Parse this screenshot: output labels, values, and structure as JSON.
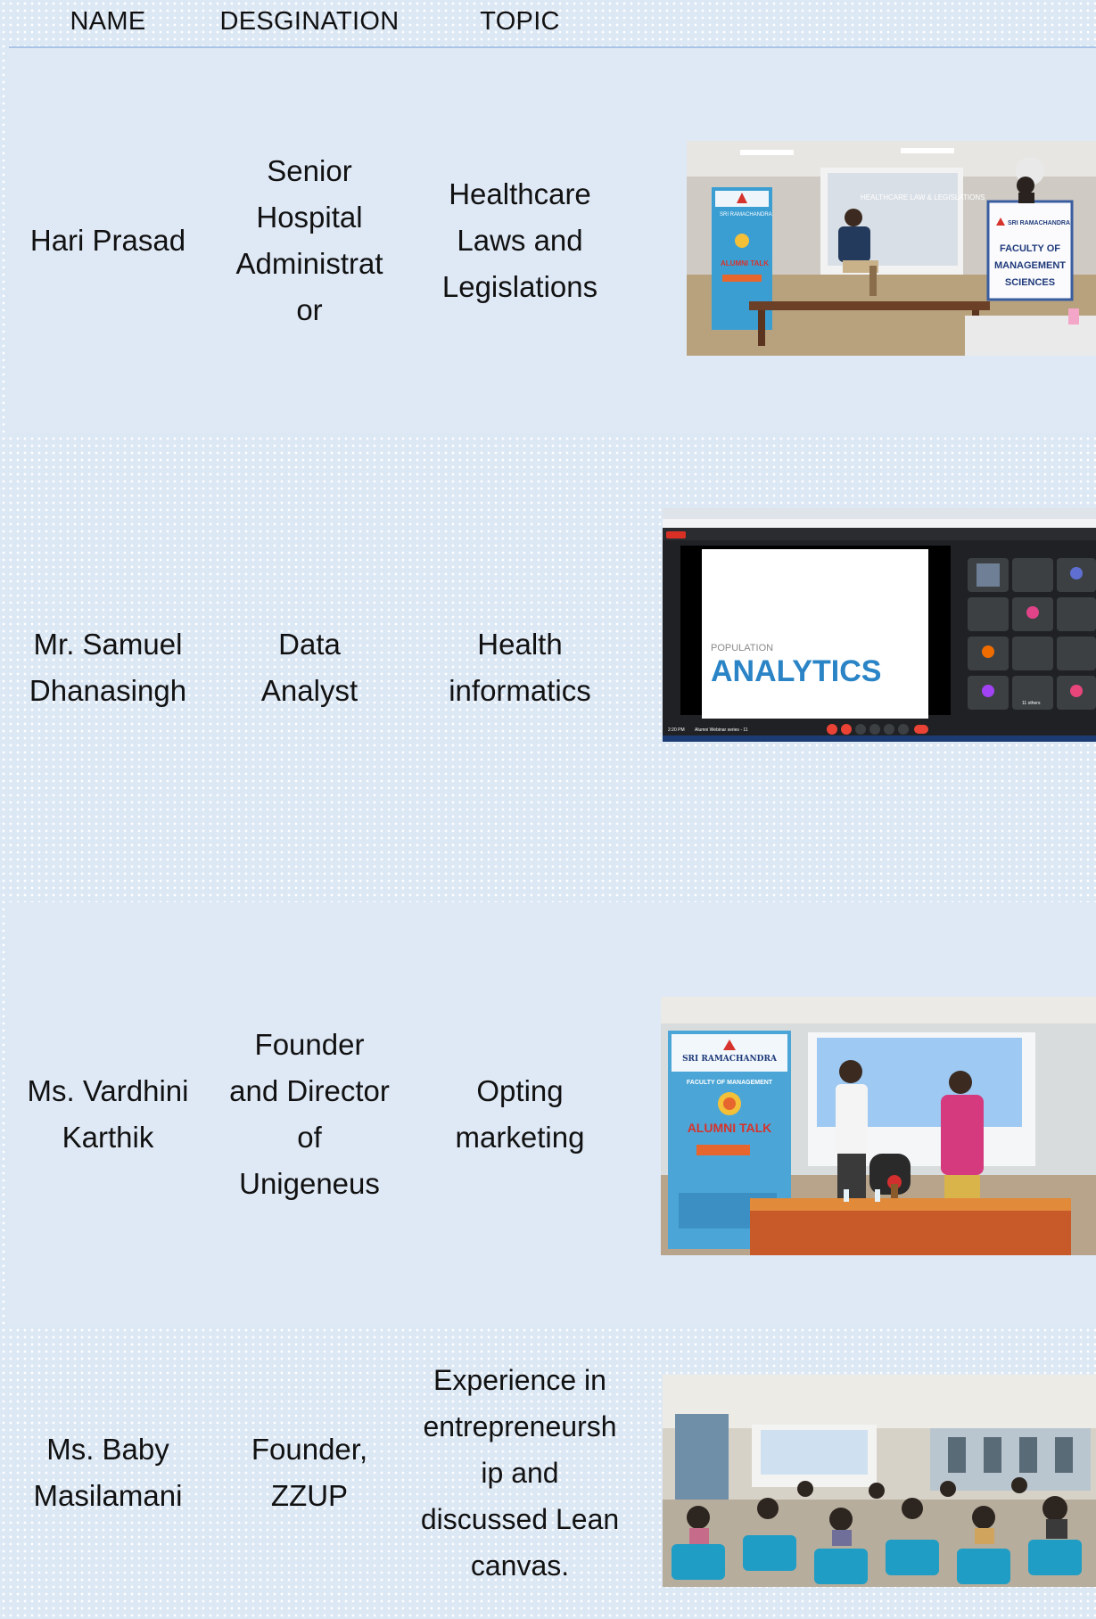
{
  "header": {
    "name": "NAME",
    "designation": "DESGINATION",
    "topic": "TOPIC"
  },
  "rows": [
    {
      "name": [
        "Hari Prasad"
      ],
      "designation": [
        "Senior",
        "Hospital",
        "Administrat",
        "or"
      ],
      "topic": [
        "Healthcare",
        "Laws and",
        "Legislations"
      ],
      "photo": {
        "banner": "ALUMNI TALK",
        "banner_org": "SRI RAMACHANDRA",
        "screen_text": "HEALTHCARE LAW & LEGISLATIONS",
        "sign_org": "SRI RAMACHANDRA",
        "sign_text": [
          "FACULTY OF",
          "MANAGEMENT",
          "SCIENCES"
        ]
      }
    },
    {
      "name": [
        "Mr. Samuel",
        "Dhanasingh"
      ],
      "designation": [
        "Data",
        "Analyst"
      ],
      "topic": [
        "Health",
        "informatics"
      ],
      "photo": {
        "slide_small": "POPULATION",
        "slide_big": "ANALYTICS",
        "call_label": "Alumni Webinar series - 11",
        "time": "2:20 PM",
        "others": "11 others"
      }
    },
    {
      "name": [
        "Ms. Vardhini",
        "Karthik"
      ],
      "designation": [
        "Founder",
        "and Director",
        "of",
        "Unigeneus"
      ],
      "topic": [
        "Opting",
        "marketing"
      ],
      "photo": {
        "banner_org": "SRI RAMACHANDRA",
        "banner_sub": "FACULTY OF MANAGEMENT",
        "banner": "ALUMNI TALK"
      }
    },
    {
      "name": [
        "Ms. Baby",
        "Masilamani"
      ],
      "designation": [
        "Founder,",
        "ZZUP"
      ],
      "topic": [
        "Experience in",
        "entrepreneursh",
        "ip and",
        "discussed Lean",
        "canvas."
      ],
      "photo": {}
    }
  ],
  "colors": {
    "background": "#dde8f5",
    "header_rule": "#a9c4e6",
    "banner_red": "#d6332c",
    "slide_blue": "#2a84c6"
  }
}
